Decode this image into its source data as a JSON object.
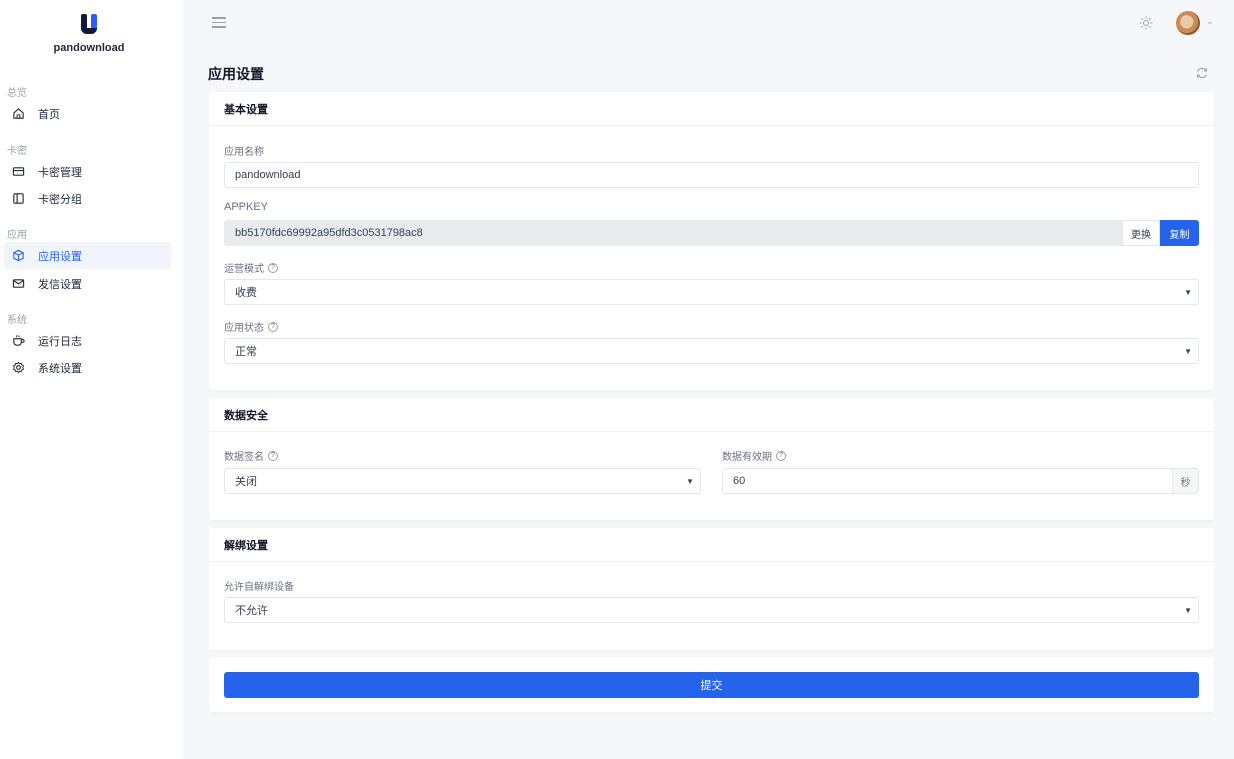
{
  "brand": {
    "name": "pandownload"
  },
  "sidebar": {
    "groups": [
      {
        "title": "总览",
        "items": [
          {
            "label": "首页",
            "icon": "home-icon"
          }
        ]
      },
      {
        "title": "卡密",
        "items": [
          {
            "label": "卡密管理",
            "icon": "card-icon"
          },
          {
            "label": "卡密分组",
            "icon": "panel-icon"
          }
        ]
      },
      {
        "title": "应用",
        "items": [
          {
            "label": "应用设置",
            "icon": "cube-icon",
            "active": true
          },
          {
            "label": "发信设置",
            "icon": "mail-icon"
          }
        ]
      },
      {
        "title": "系统",
        "items": [
          {
            "label": "运行日志",
            "icon": "cup-icon"
          },
          {
            "label": "系统设置",
            "icon": "gear-icon"
          }
        ]
      }
    ]
  },
  "header": {
    "page_title": "应用设置"
  },
  "basic": {
    "title": "基本设置",
    "app_name_label": "应用名称",
    "app_name_value": "pandownload",
    "appkey_label": "APPKEY",
    "appkey_value": "bb5170fdc69992a95dfd3c0531798ac8",
    "change_label": "更换",
    "copy_label": "复制",
    "mode_label": "运营模式",
    "mode_value": "收费",
    "status_label": "应用状态",
    "status_value": "正常"
  },
  "security": {
    "title": "数据安全",
    "sign_label": "数据签名",
    "sign_value": "关闭",
    "expire_label": "数据有效期",
    "expire_value": "60",
    "expire_unit": "秒"
  },
  "unbind": {
    "title": "解绑设置",
    "allow_label": "允许自解绑设备",
    "allow_value": "不允许"
  },
  "submit_label": "提交",
  "colors": {
    "accent": "#2563eb",
    "background": "#f5f7fa"
  }
}
